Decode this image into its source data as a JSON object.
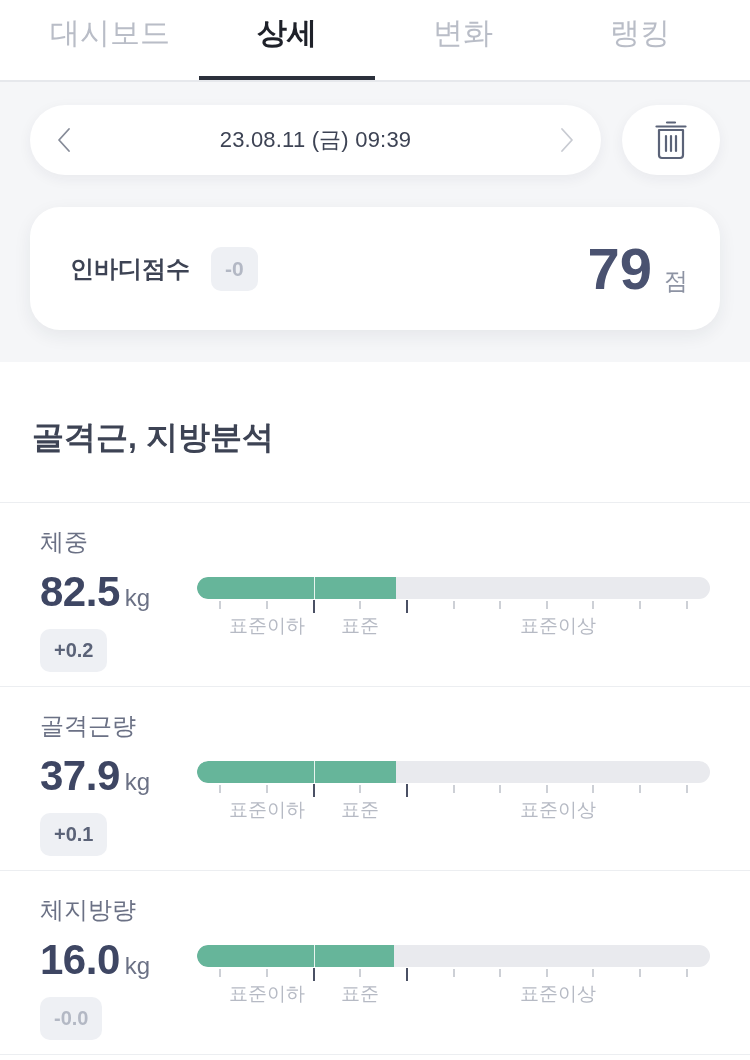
{
  "tabs": [
    {
      "label": "대시보드",
      "selected": false
    },
    {
      "label": "상세",
      "selected": true
    },
    {
      "label": "변화",
      "selected": false
    },
    {
      "label": "랭킹",
      "selected": false
    }
  ],
  "date_nav": {
    "date": "23.08.11 (금) 09:39",
    "prev": {
      "disabled": false
    },
    "next": {
      "disabled": true
    }
  },
  "score_card": {
    "label": "인바디점수",
    "change": {
      "text": "-0",
      "muted": true
    },
    "score": "79",
    "unit": "점"
  },
  "section": {
    "title": "골격근, 지방분석"
  },
  "metrics": [
    {
      "name": "체중",
      "value": "82.5",
      "unit": "kg",
      "change": {
        "text": "+0.2",
        "muted": false
      },
      "level": 0.388,
      "scale_labels": [
        "표준이하",
        "표준",
        "표준이상"
      ]
    },
    {
      "name": "골격근량",
      "value": "37.9",
      "unit": "kg",
      "change": {
        "text": "+0.1",
        "muted": false
      },
      "level": 0.388,
      "scale_labels": [
        "표준이하",
        "표준",
        "표준이상"
      ]
    },
    {
      "name": "체지방량",
      "value": "16.0",
      "unit": "kg",
      "change": {
        "text": "-0.0",
        "muted": true
      },
      "level": 0.384,
      "scale_labels": [
        "표준이하",
        "표준",
        "표준이상"
      ]
    }
  ]
}
